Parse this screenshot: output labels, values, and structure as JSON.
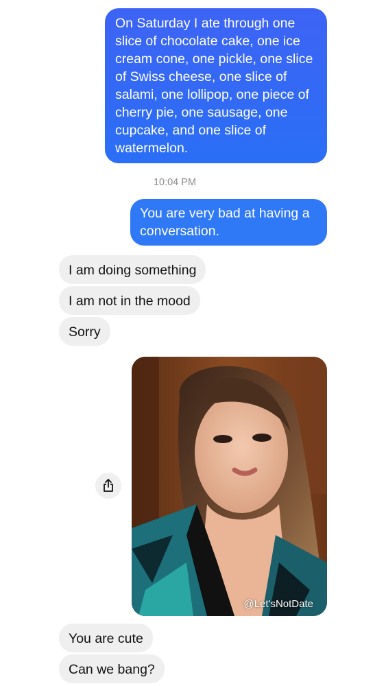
{
  "conversation": {
    "messages": [
      {
        "sender": "me",
        "text": "On Saturday I ate through one slice of chocolate cake, one ice cream cone, one pickle, one slice of Swiss cheese, one slice of salami, one lollipop, one piece of cherry pie, one sausage, one cupcake, and one slice of watermelon."
      },
      {
        "sender": "me",
        "text": "You are very bad at having a conversation."
      },
      {
        "sender": "them",
        "text": "I am doing something"
      },
      {
        "sender": "them",
        "text": "I am not in the mood"
      },
      {
        "sender": "them",
        "text": "Sorry"
      },
      {
        "sender": "them",
        "text": "You are cute"
      },
      {
        "sender": "them",
        "text": "Can we bang?"
      }
    ],
    "timestamp": "10:04 PM",
    "photo": {
      "watermark": "@Let'sNotDate"
    },
    "share_icon": "share-icon"
  },
  "colors": {
    "sent_bubble": "#2f6ff5",
    "received_bubble": "#efefef",
    "timestamp": "#8a8a8e"
  }
}
